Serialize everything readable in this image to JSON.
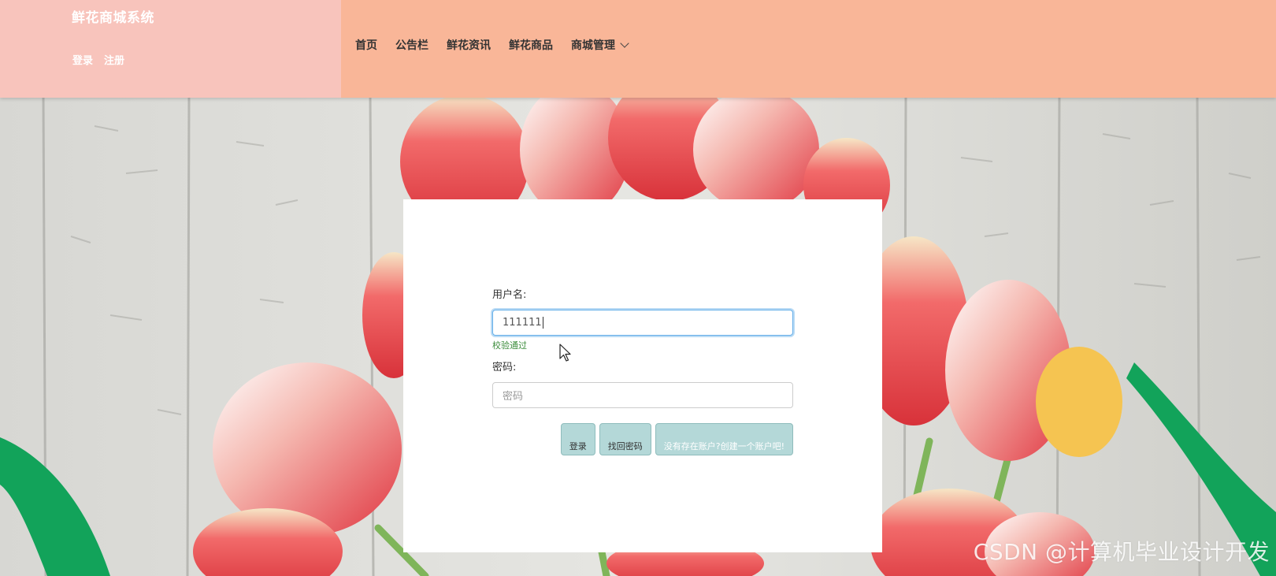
{
  "colors": {
    "brand_bg": "#f8c4bc",
    "nav_bg": "#f9b698",
    "button_bg": "#b4d8d8",
    "valid_text": "#3c8d3c"
  },
  "header": {
    "brand_title": "鲜花商城系统",
    "auth": {
      "login": "登录",
      "register": "注册"
    },
    "nav": {
      "home": "首页",
      "notice": "公告栏",
      "news": "鲜花资讯",
      "products": "鲜花商品",
      "manage": "商城管理"
    }
  },
  "login_form": {
    "username_label": "用户名:",
    "username_value": "111111",
    "username_status": "校验通过",
    "password_label": "密码:",
    "password_placeholder": "密码",
    "buttons": {
      "login": "登录",
      "recover": "找回密码",
      "register": "没有存在账户?创建一个账户吧!"
    }
  },
  "watermark": "CSDN @计算机毕业设计开发"
}
